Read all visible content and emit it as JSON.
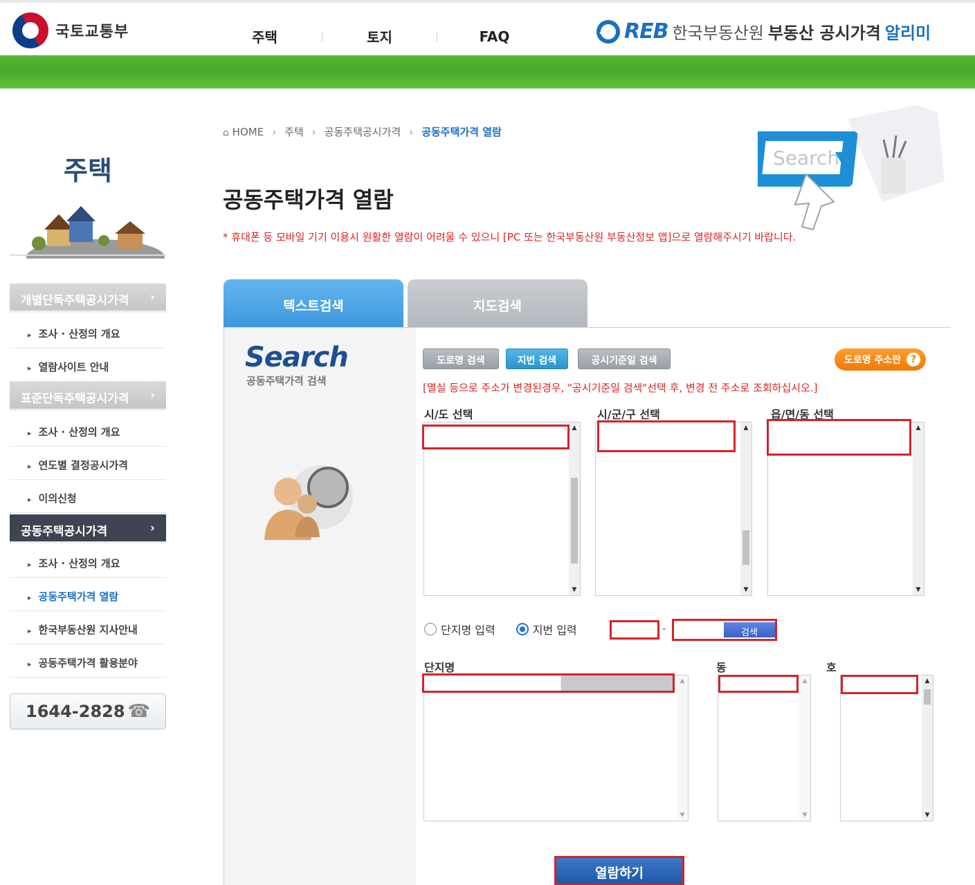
{
  "header": {
    "gov_name": "국토교통부",
    "nav": [
      "주택",
      "토지",
      "FAQ"
    ],
    "reb_mark": "REB",
    "reb_org": "한국부동산원",
    "reb_service": "부동산 공시가격",
    "reb_service_accent": "알리미"
  },
  "sidebar": {
    "title": "주택",
    "categories": [
      {
        "label": "개별단독주택공시가격",
        "chevron": "›"
      },
      {
        "label": "표준단독주택공시가격",
        "chevron": "›"
      },
      {
        "label": "공동주택공시가격",
        "chevron": "›"
      }
    ],
    "group1": [
      "조사 · 산정의 개요",
      "열람사이트 안내"
    ],
    "group2": [
      "조사 · 산정의 개요",
      "연도별 결정공시가격",
      "이의신청"
    ],
    "group3": [
      "조사 · 산정의 개요",
      "공동주택가격 열람",
      "한국부동산원 지사안내",
      "공동주택가격 활용분야"
    ],
    "phone": "1644-2828"
  },
  "breadcrumb": [
    "HOME",
    "주택",
    "공동주택공시가격",
    "공동주택가격 열람"
  ],
  "page_title": "공동주택가격 열람",
  "notice": "* 휴대폰 등 모바일 기기 이용시 원활한 열람이 어려울 수 있으니 [PC 또는 한국부동산원 부동산정보 앱]으로 열람해주시기 바랍니다.",
  "hero_search_text": "Search",
  "tabs": [
    "텍스트검색",
    "지도검색"
  ],
  "panel": {
    "search_logo": "Search",
    "search_sub": "공동주택가격 검색",
    "buttons": [
      "도로명 검색",
      "지번 검색",
      "공시기준일 검색"
    ],
    "road_help": "도로명 주소란",
    "warn": "[멸실 등으로 주소가 변경된경우, \"공시기준일 검색\"선택 후, 변경 전 주소로 조회하십시오.]",
    "labels": {
      "sido": "시/도 선택",
      "sigungu": "시/군/구 선택",
      "eupmyeondong": "읍/면/동 선택",
      "danji": "단지명",
      "dong": "동",
      "ho": "호"
    },
    "radio": {
      "option1": "단지명 입력",
      "option2": "지번 입력",
      "selected": "지번 입력"
    },
    "lot_separator": "-",
    "search_button": "검색",
    "submit": "열람하기"
  },
  "colors": {
    "accent_blue": "#1a6fc4",
    "green_bar": "#4aa829",
    "highlight_red": "#d4222a",
    "notice_red": "#dd2222"
  }
}
